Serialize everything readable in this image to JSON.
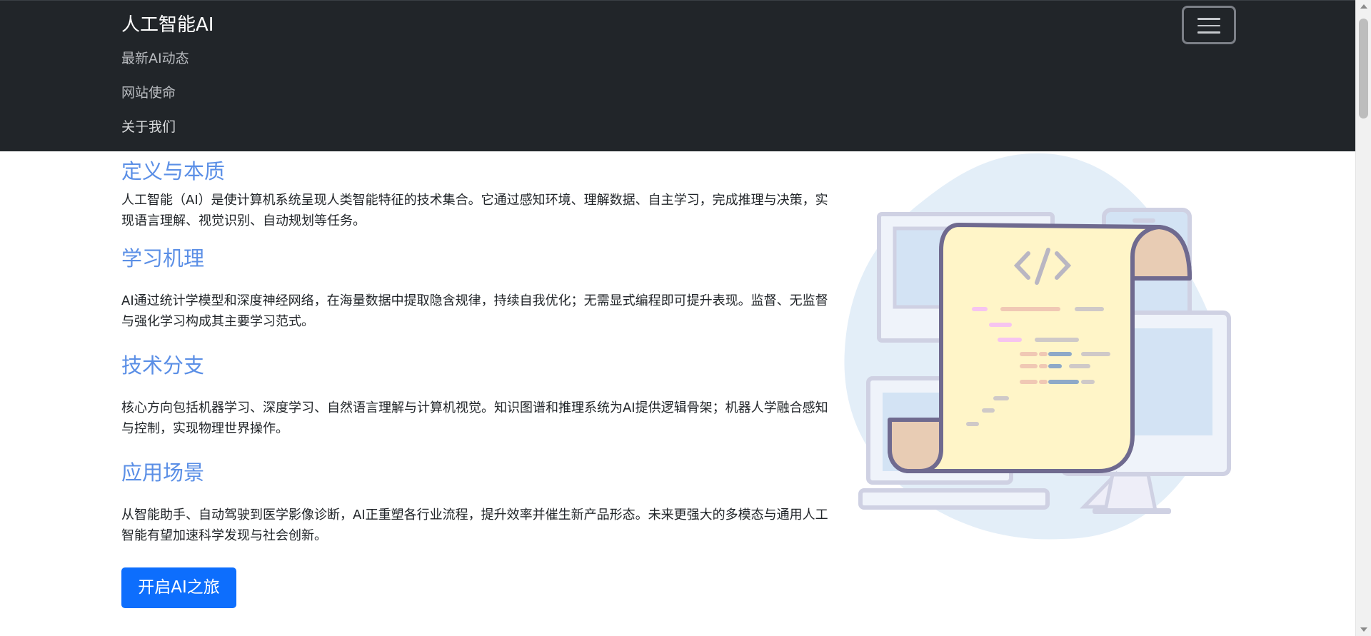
{
  "navbar": {
    "brand": "人工智能AI",
    "links": [
      {
        "label": "最新AI动态"
      },
      {
        "label": "网站使命"
      },
      {
        "label": "关于我们"
      }
    ],
    "toggler_icon": "hamburger-icon"
  },
  "sections": [
    {
      "title": "定义与本质",
      "text": "人工智能（AI）是使计算机系统呈现人类智能特征的技术集合。它通过感知环境、理解数据、自主学习，完成推理与决策，实现语言理解、视觉识别、自动规划等任务。"
    },
    {
      "title": "学习机理",
      "text": "AI通过统计学模型和深度神经网络，在海量数据中提取隐含规律，持续自我优化；无需显式编程即可提升表现。监督、无监督与强化学习构成其主要学习范式。"
    },
    {
      "title": "技术分支",
      "text": "核心方向包括机器学习、深度学习、自然语言理解与计算机视觉。知识图谱和推理系统为AI提供逻辑骨架；机器人学融合感知与控制，实现物理世界操作。"
    },
    {
      "title": "应用场景",
      "text": "从智能助手、自动驾驶到医学影像诊断，AI正重塑各行业流程，提升效率并催生新产品形态。未来更强大的多模态与通用人工智能有望加速科学发现与社会创新。"
    }
  ],
  "cta": {
    "label": "开启AI之旅"
  },
  "colors": {
    "navbar_bg": "#212529",
    "heading": "#5b8fe6",
    "primary": "#0d6efd",
    "blob": "#e3eef8",
    "scroll": "#fff5c8",
    "outline": "#6f6a8f"
  },
  "illustration": {
    "icon": "code-scroll-devices-illustration"
  }
}
